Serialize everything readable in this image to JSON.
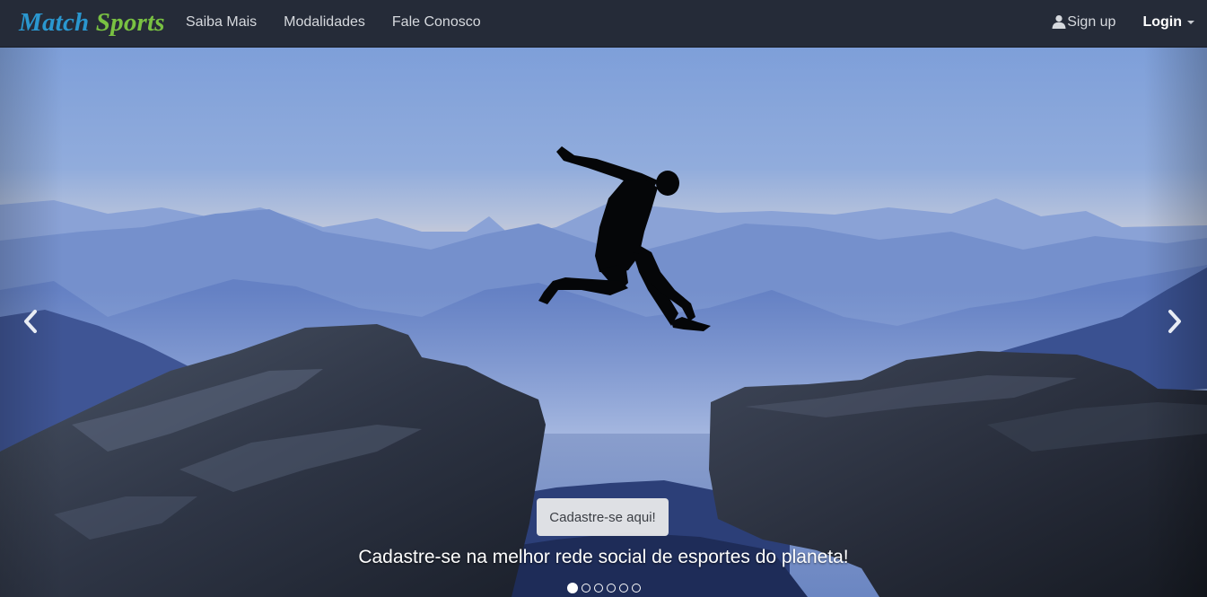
{
  "brand": {
    "word1": "Match",
    "word2": "Sports",
    "color1": "#2a97cf",
    "color2": "#79c142"
  },
  "nav": {
    "items": [
      {
        "label": "Saiba Mais"
      },
      {
        "label": "Modalidades"
      },
      {
        "label": "Fale Conosco"
      }
    ],
    "signup_label": "Sign up",
    "login_label": "Login"
  },
  "hero": {
    "button_label": "Cadastre-se aqui!",
    "caption": "Cadastre-se na melhor rede social de esportes do planeta!",
    "slide_count": 6,
    "active_slide": 1
  },
  "icons": [
    "user-icon",
    "caret-down-icon",
    "chevron-left-icon",
    "chevron-right-icon"
  ],
  "colors": {
    "navbar_bg": "#252b38",
    "nav_text": "#d6d9de"
  }
}
